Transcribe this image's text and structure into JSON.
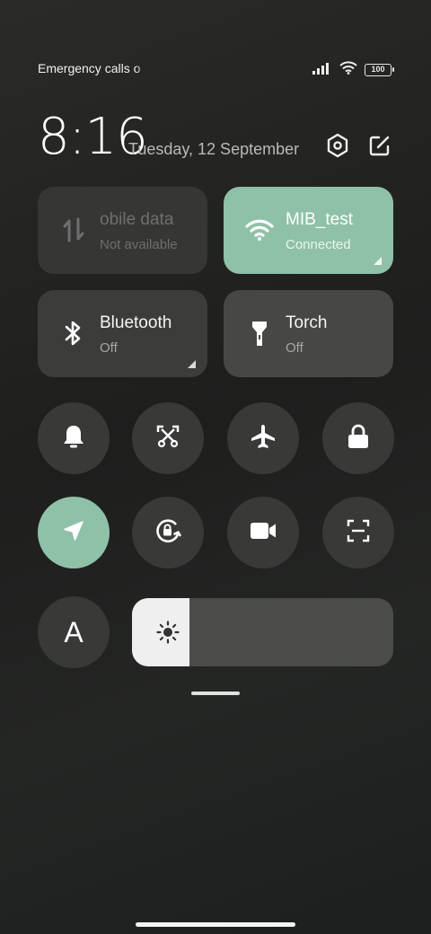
{
  "status_bar": {
    "carrier_text": "Emergency calls o",
    "battery_level": "100",
    "icons": [
      "signal-icon",
      "wifi-icon",
      "battery-icon"
    ]
  },
  "header": {
    "time": "8:16",
    "date": "Tuesday, 12 September",
    "settings_icon": "settings-icon",
    "edit_icon": "edit-icon"
  },
  "tiles": [
    {
      "title": "obile data",
      "subtitle": "Not available",
      "icon": "mobile-data-icon",
      "state": "disabled"
    },
    {
      "title": "MIB_test",
      "subtitle": "Connected",
      "icon": "wifi-icon",
      "state": "active"
    },
    {
      "title": "Bluetooth",
      "subtitle": "Off",
      "icon": "bluetooth-icon",
      "state": "off"
    },
    {
      "title": "Torch",
      "subtitle": "Off",
      "icon": "torch-icon",
      "state": "off"
    }
  ],
  "toggles_row1": [
    "bell-icon",
    "screenshot-icon",
    "airplane-icon",
    "lock-icon"
  ],
  "toggles_row2": [
    "location-icon",
    "rotation-lock-icon",
    "video-camera-icon",
    "scanner-icon"
  ],
  "font_toggle_label": "A",
  "brightness": {
    "level": 0.22,
    "icon": "sun-icon"
  },
  "colors": {
    "accent": "#8fc1a9",
    "tile": "#3c3c3b",
    "round": "#393938"
  }
}
